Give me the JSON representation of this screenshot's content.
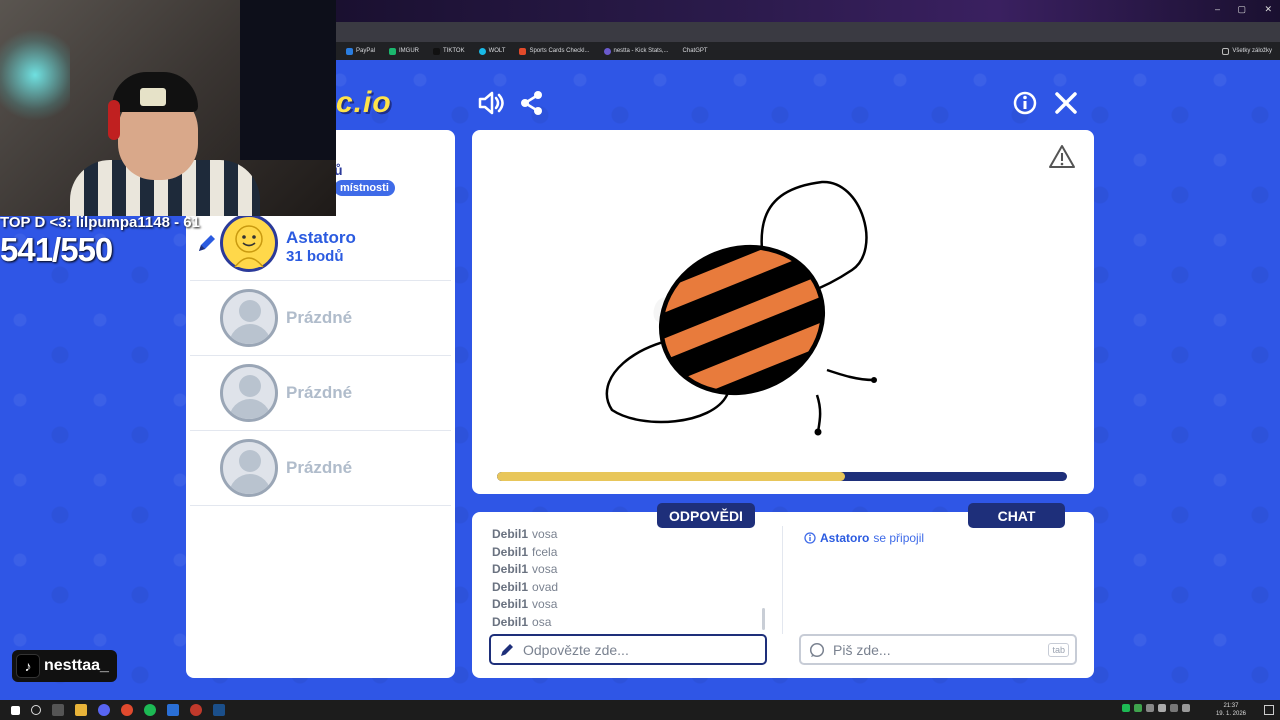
{
  "browser": {
    "bookmarks": [
      {
        "label": "PayPal"
      },
      {
        "label": "IMGUR"
      },
      {
        "label": "TIKTOK"
      },
      {
        "label": "WOLT"
      },
      {
        "label": "Sports Cards Checkl..."
      },
      {
        "label": "nestta - Kick Stats,..."
      },
      {
        "label": "ChatGPT"
      }
    ],
    "all_bookmarks": "Všetky záložky"
  },
  "stream_overlay": {
    "line1": "TOP D <3: lilpumpa1148 - 61",
    "counter": "541/550",
    "tiktok_handle": "nesttaa_"
  },
  "game": {
    "logo_text": "c.io",
    "room": {
      "points_label": "ů",
      "badge": "místnosti"
    },
    "players": [
      {
        "name": "Astatoro",
        "points": "31 bodů",
        "active": true
      },
      {
        "name": "Prázdné",
        "points": "",
        "active": false
      },
      {
        "name": "Prázdné",
        "points": "",
        "active": false
      },
      {
        "name": "Prázdné",
        "points": "",
        "active": false
      }
    ],
    "canvas": {
      "watermark": "c.io",
      "timer_progress": 0.61
    },
    "tabs": {
      "answers": "ODPOVĚDI",
      "chat": "CHAT"
    },
    "answers": [
      {
        "user": "Debil1",
        "text": "vosa"
      },
      {
        "user": "Debil1",
        "text": "fcela"
      },
      {
        "user": "Debil1",
        "text": "vosa"
      },
      {
        "user": "Debil1",
        "text": "ovad"
      },
      {
        "user": "Debil1",
        "text": "vosa"
      },
      {
        "user": "Debil1",
        "text": "osa"
      }
    ],
    "chat_message": {
      "user": "Astatoro",
      "text": "se připojil"
    },
    "answer_input": {
      "placeholder": "Odpovězte zde..."
    },
    "chat_input": {
      "placeholder": "Piš zde...",
      "hint": "tab"
    }
  },
  "taskbar": {
    "time": "21:37",
    "date": "19. 1. 2026"
  },
  "colors": {
    "page_bg": "#2f56e6",
    "navy": "#1e2f7a",
    "accent_blue": "#2b5be0",
    "timer_fill": "#e8c65a",
    "bee_orange": "#e87b3c"
  }
}
